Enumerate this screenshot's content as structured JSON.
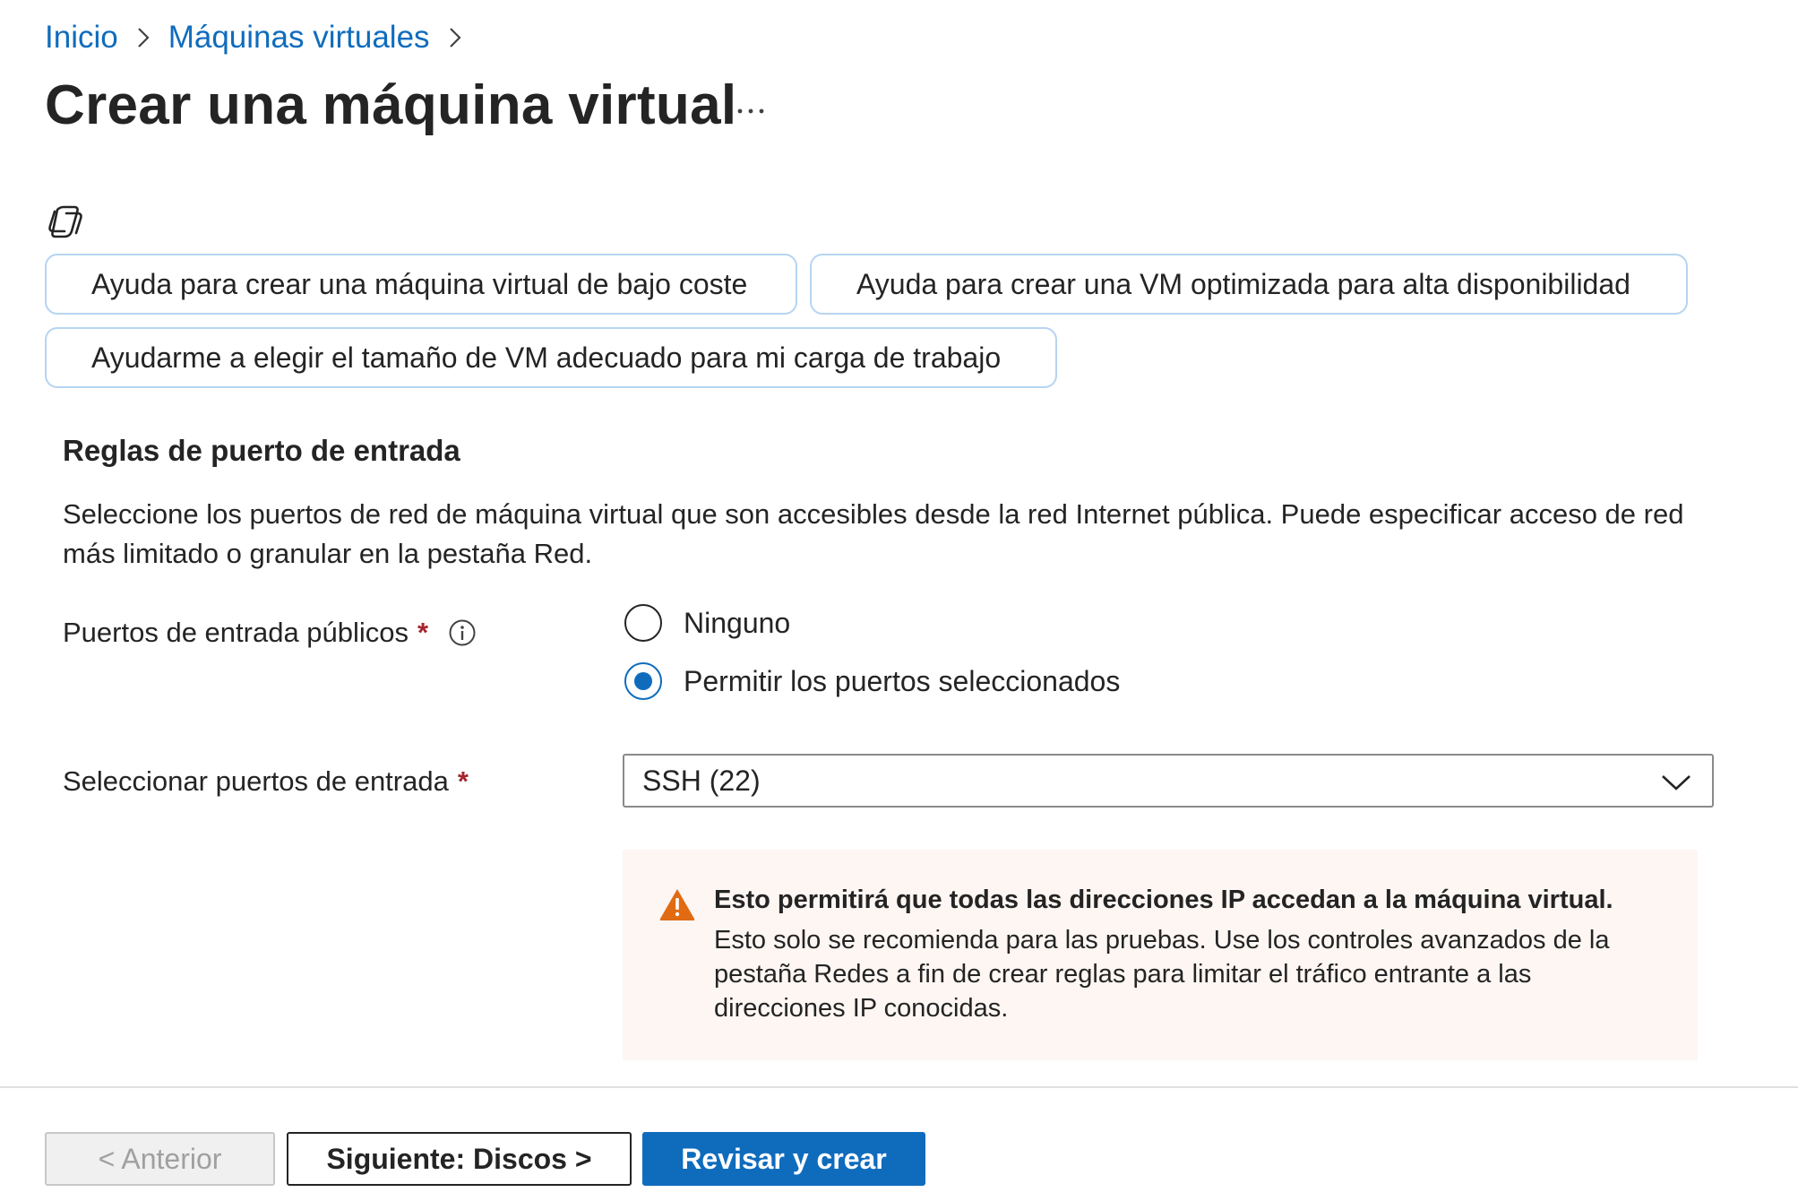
{
  "breadcrumb": {
    "items": [
      {
        "label": "Inicio"
      },
      {
        "label": "Máquinas virtuales"
      }
    ]
  },
  "header": {
    "title": "Crear una máquina virtual",
    "more_label": "···"
  },
  "copilot": {
    "icon": "copilot-icon",
    "suggestions": [
      "Ayuda para crear una máquina virtual de bajo coste",
      "Ayuda para crear una VM optimizada para alta disponibilidad",
      "Ayudarme a elegir el tamaño de VM adecuado para mi carga de trabajo"
    ]
  },
  "inbound_rules": {
    "title": "Reglas de puerto de entrada",
    "description": "Seleccione los puertos de red de máquina virtual que son accesibles desde la red Internet pública. Puede especificar acceso de red más limitado o granular en la pestaña Red.",
    "public_ports": {
      "label": "Puertos de entrada públicos",
      "required_mark": "*",
      "info_icon": "info-icon",
      "options": [
        {
          "label": "Ninguno",
          "selected": false
        },
        {
          "label": "Permitir los puertos seleccionados",
          "selected": true
        }
      ]
    },
    "select_ports": {
      "label": "Seleccionar puertos de entrada",
      "required_mark": "*",
      "value": "SSH (22)"
    },
    "warning": {
      "icon": "warning-icon",
      "title": "Esto permitirá que todas las direcciones IP accedan a la máquina virtual.",
      "body": " Esto solo se recomienda para las pruebas.  Use los controles avanzados de la pestaña Redes a fin de crear reglas para limitar el tráfico entrante a las direcciones IP conocidas."
    }
  },
  "footer": {
    "prev_label": "< Anterior",
    "next_label": "Siguiente: Discos >",
    "review_label": "Revisar y crear"
  },
  "colors": {
    "accent": "#0f6cbd",
    "required": "#a4262c",
    "warning_icon": "#e06b12",
    "warning_bg": "#fdf6f3",
    "chip_border": "#b6d4f2"
  }
}
